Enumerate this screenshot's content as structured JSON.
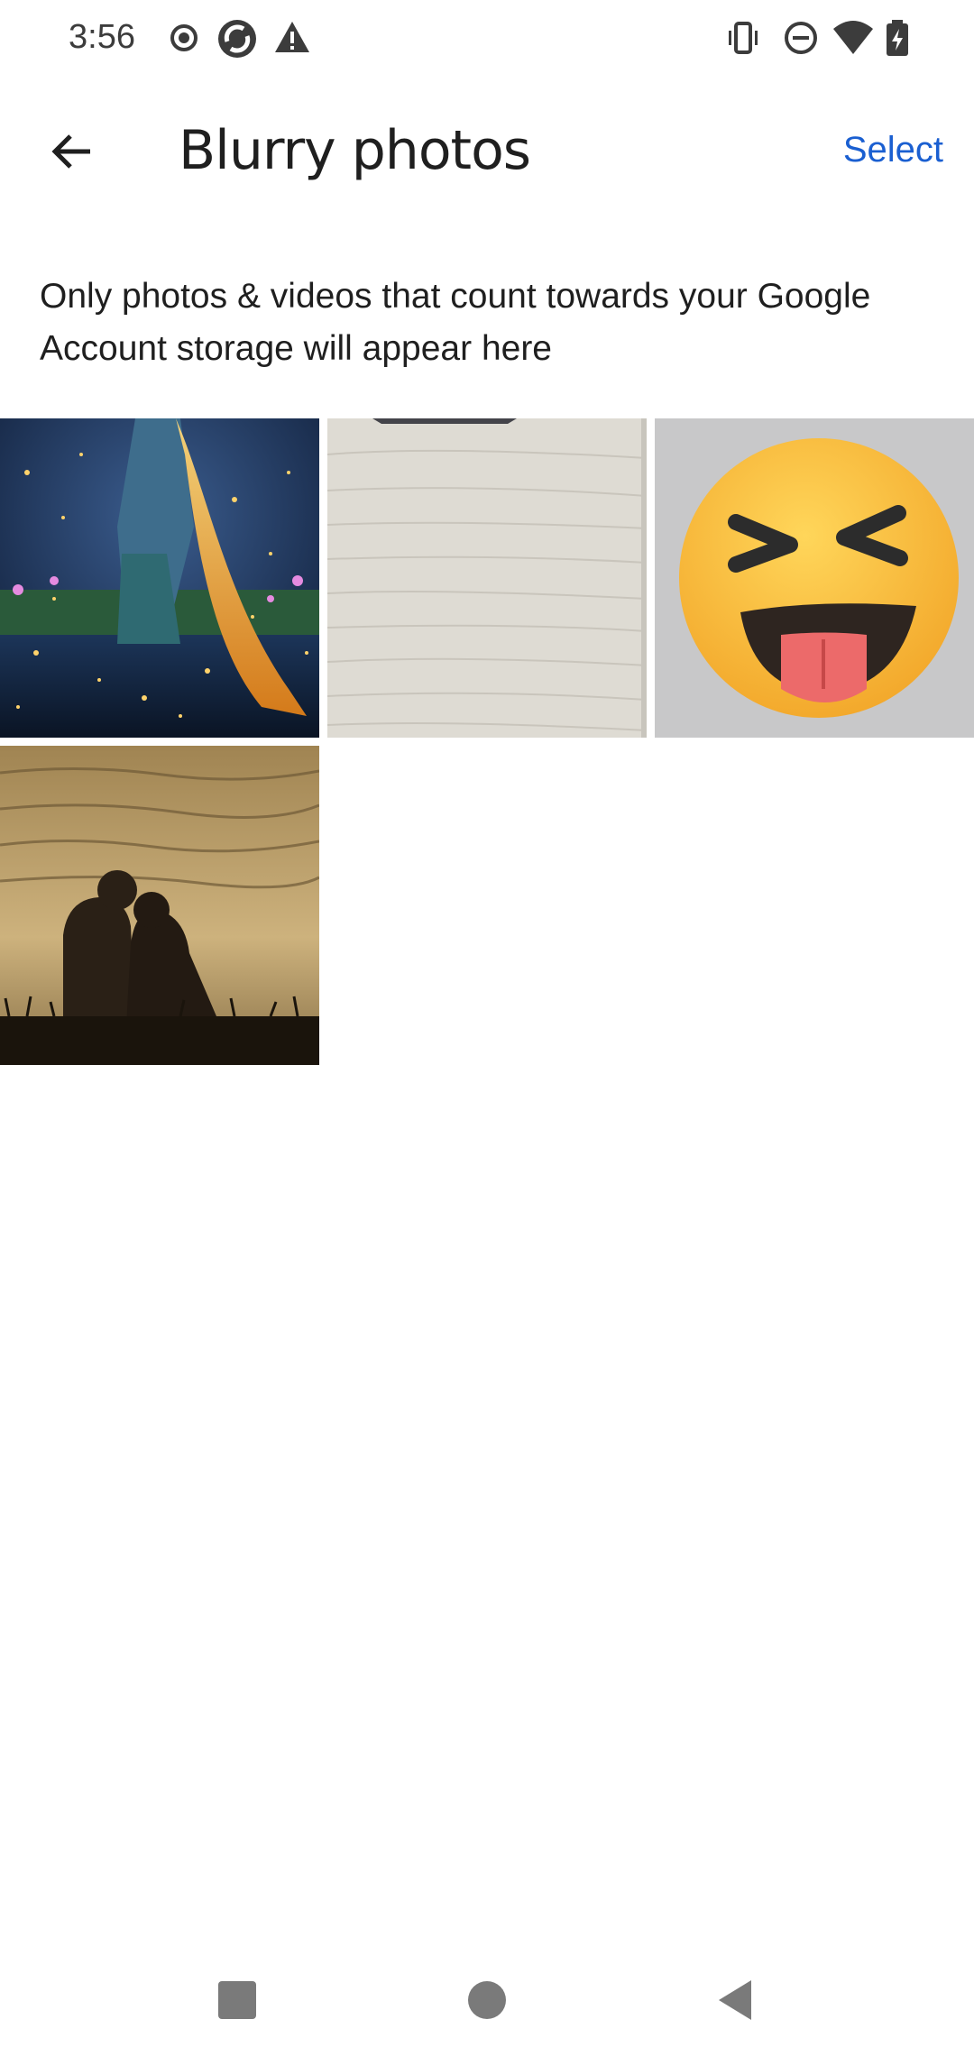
{
  "status_bar": {
    "time": "3:56",
    "left_icons": [
      "record-icon",
      "sync-app-icon",
      "warning-icon"
    ],
    "right_icons": [
      "vibrate-icon",
      "do-not-disturb-icon",
      "wifi-icon",
      "battery-charging-icon"
    ]
  },
  "app_bar": {
    "title": "Blurry photos",
    "back_icon": "arrow-back-icon",
    "select_label": "Select"
  },
  "info": {
    "text": "Only photos & videos that count towards your Google Account storage will appear here"
  },
  "photos": [
    {
      "name": "photo-fairy-tale-water"
    },
    {
      "name": "photo-wood-texture"
    },
    {
      "name": "photo-laughing-emoji"
    },
    {
      "name": "photo-couple-sunset"
    }
  ],
  "colors": {
    "accent": "#1a5fd1",
    "text_primary": "#1f1f1f",
    "nav_icon": "#7a7a7a"
  },
  "nav_bar": {
    "buttons": [
      "recents-square-icon",
      "home-circle-icon",
      "back-triangle-icon"
    ]
  }
}
